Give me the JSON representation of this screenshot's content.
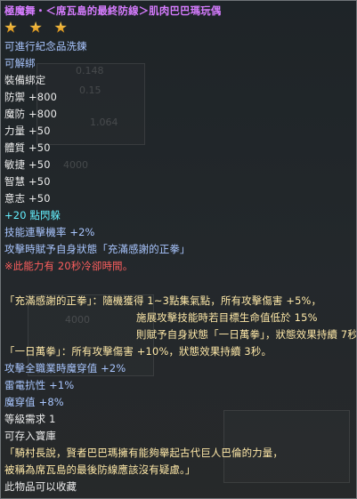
{
  "item": {
    "title": "極魔舞・＜席瓦島的最終防線＞肌肉巴巴瑪玩偶",
    "star_count": 3,
    "lines": {
      "l1": "可進行紀念品洗鍊",
      "l2": "可解綁",
      "l3": "裝備綁定",
      "l4": "防禦 +800",
      "l5": "魔防 +800",
      "l6": "力量 +50",
      "l7": "體質 +50",
      "l8": "敏捷 +50",
      "l9": "智慧 +50",
      "l10": "意志 +50",
      "l11": "+20 點閃躲",
      "l12": "技能連擊機率 +2%",
      "l13": "攻擊時賦予自身狀態「充滿感謝的正拳」",
      "l14": "※此能力有 20秒冷卻時間。",
      "l15": "「充滿感謝的正拳」：隨機獲得 1~3點集氣點，所有攻擊傷害 +5%，",
      "l16": "施展攻擊技能時若目標生命值低於 15%",
      "l17": "則賦予自身狀態「一日萬拳」，狀態效果持續 7秒。",
      "l18": "「一日萬拳」：所有攻擊傷害 +10%，狀態效果持續 3秒。",
      "l19": "攻擊全職業時魔穿值 +2%",
      "l20": "雷電抗性 +1%",
      "l21": "魔穿值 +8%",
      "l22": "等級需求 1",
      "l23": "可存入寶庫",
      "l24": "「騎村長說，賢者巴巴瑪擁有能夠舉起古代巨人巴倫的力量，",
      "l25": "被稱為席瓦島的最後防線應該沒有疑慮。」",
      "l26": "此物品可以收藏"
    }
  },
  "background": {
    "t1": "0.148",
    "t2": "0.15",
    "t3": "1.064",
    "t4": "4000",
    "t5": "4000"
  },
  "colors": {
    "title": "#d67cff",
    "white": "#ececec",
    "blue": "#a9c6ff",
    "cyan": "#64f0ff",
    "red": "#ff5f5f",
    "yellow": "#ffe9a8",
    "star": "#f2b632"
  },
  "icons": [
    "star-icon"
  ]
}
